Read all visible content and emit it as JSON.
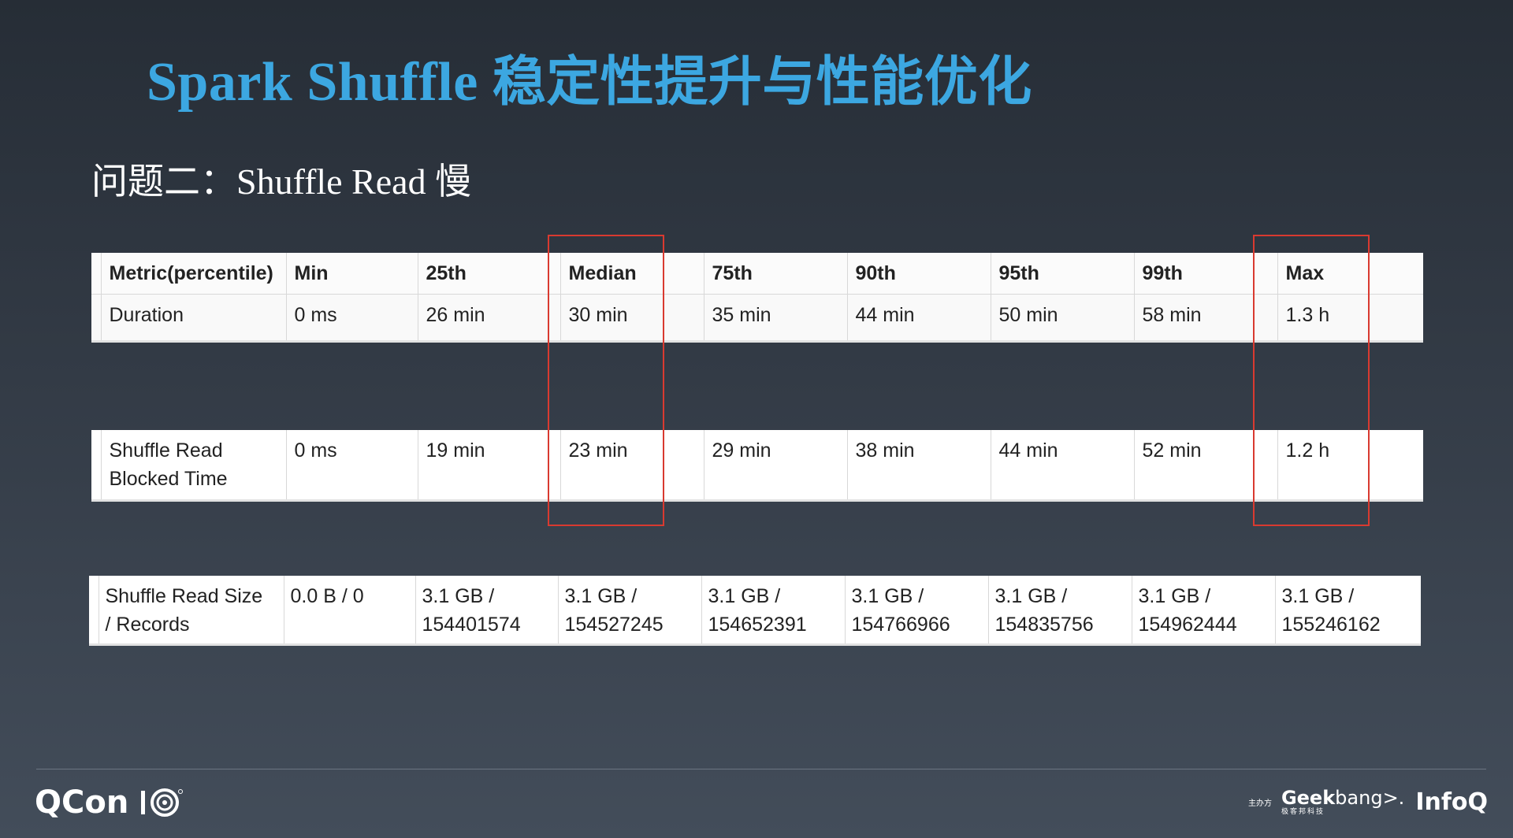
{
  "slide": {
    "title_latin": "Spark Shuffle",
    "title_cjk": "稳定性提升与性能优化",
    "subtitle": "问题二：Shuffle Read 慢"
  },
  "tables": {
    "t1": {
      "header": [
        "Metric(percentile)",
        "Min",
        "25th",
        "Median",
        "75th",
        "90th",
        "95th",
        "99th",
        "Max"
      ],
      "row": [
        "Duration",
        "0 ms",
        "26 min",
        "30 min",
        "35 min",
        "44 min",
        "50 min",
        "58 min",
        "1.3 h"
      ]
    },
    "t2": {
      "row": [
        "Shuffle Read\nBlocked Time",
        "0 ms",
        "19 min",
        "23 min",
        "29 min",
        "38 min",
        "44 min",
        "52 min",
        "1.2 h"
      ]
    },
    "t3": {
      "row": [
        "Shuffle Read Size\n/ Records",
        "0.0 B / 0",
        "3.1 GB /\n154401574",
        "3.1 GB /\n154527245",
        "3.1 GB /\n154652391",
        "3.1 GB /\n154766966",
        "3.1 GB /\n154835756",
        "3.1 GB /\n154962444",
        "3.1 GB /\n155246162"
      ]
    }
  },
  "highlights": [
    "Median",
    "Max"
  ],
  "footer": {
    "brand": "QCon",
    "brand_mark": "10",
    "host_label": "主办方",
    "geekbang_bold": "Geek",
    "geekbang_rest": "bang",
    "geekbang_suffix": ">.",
    "geekbang_sub": "极客邦科技",
    "infoq": "InfoQ"
  },
  "colors": {
    "title": "#3ca7e1",
    "highlight_box": "#d93a30",
    "background_top": "#262d36",
    "background_bottom": "#434d5a"
  }
}
